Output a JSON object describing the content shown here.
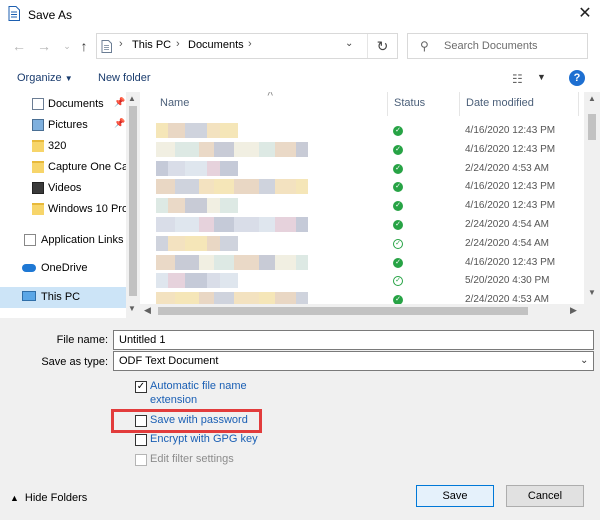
{
  "window": {
    "title": "Save As"
  },
  "nav": {
    "crumbs": [
      "This PC",
      "Documents"
    ],
    "search_placeholder": "Search Documents"
  },
  "toolbar": {
    "organize_label": "Organize",
    "new_folder_label": "New folder",
    "help_label": "?"
  },
  "sidebar": {
    "items": [
      {
        "label": "Documents",
        "icon": "documents-icon",
        "pinned": true
      },
      {
        "label": "Pictures",
        "icon": "pictures-icon",
        "pinned": true
      },
      {
        "label": "320",
        "icon": "folder-icon"
      },
      {
        "label": "Capture One Cat",
        "icon": "folder-icon"
      },
      {
        "label": "Videos",
        "icon": "videos-icon"
      },
      {
        "label": "Windows 10 Pro",
        "icon": "folder-icon"
      },
      {
        "label": "Application Links",
        "icon": "application-links-icon"
      },
      {
        "label": "OneDrive",
        "icon": "onedrive-icon"
      },
      {
        "label": "This PC",
        "icon": "this-pc-icon",
        "selected": true
      }
    ]
  },
  "filelist": {
    "columns": [
      "Name",
      "Status",
      "Date modified"
    ],
    "rows": [
      {
        "status": "synced",
        "date": "4/16/2020 12:43 PM"
      },
      {
        "status": "synced",
        "date": "4/16/2020 12:43 PM"
      },
      {
        "status": "synced",
        "date": "2/24/2020 4:53 AM"
      },
      {
        "status": "synced",
        "date": "4/16/2020 12:43 PM"
      },
      {
        "status": "synced",
        "date": "4/16/2020 12:43 PM"
      },
      {
        "status": "synced",
        "date": "2/24/2020 4:54 AM"
      },
      {
        "status": "available",
        "date": "2/24/2020 4:54 AM"
      },
      {
        "status": "synced",
        "date": "4/16/2020 12:43 PM"
      },
      {
        "status": "available",
        "date": "5/20/2020 4:30 PM"
      },
      {
        "status": "synced",
        "date": "2/24/2020 4:53 AM"
      }
    ]
  },
  "form": {
    "file_name_label": "File name:",
    "file_name_value": "Untitled 1",
    "save_type_label": "Save as type:",
    "save_type_value": "ODF Text Document"
  },
  "options": {
    "auto_ext_line1": "Automatic file name",
    "auto_ext_line2": "extension",
    "auto_ext_checked": true,
    "password_label": "Save with password",
    "gpg_label": "Encrypt with GPG key",
    "filter_label": "Edit filter settings"
  },
  "footer": {
    "hide_folders_label": "Hide Folders",
    "save_label": "Save",
    "cancel_label": "Cancel"
  },
  "colors": {
    "highlight_box": "#e23c3c",
    "status_green": "#27a345",
    "selection": "#cce4f7"
  }
}
